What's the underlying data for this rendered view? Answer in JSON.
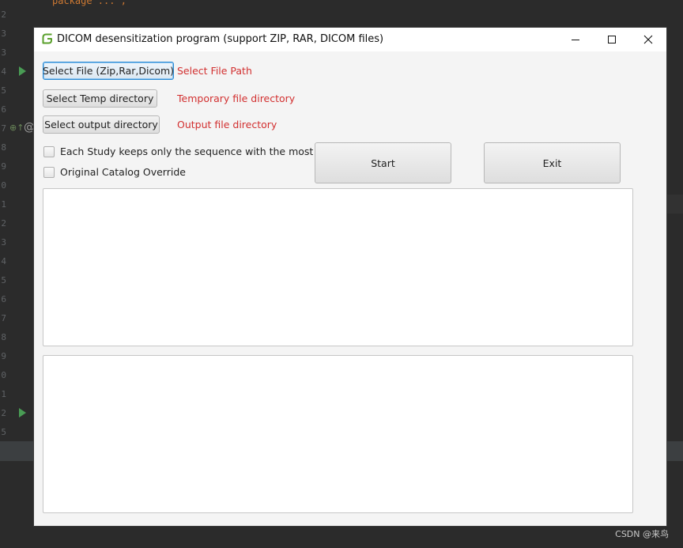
{
  "ide": {
    "line_numbers": [
      "2",
      "3",
      "3",
      "4",
      "5",
      "6",
      "7",
      "8",
      "9",
      "0",
      "1",
      "2",
      "3",
      "4",
      "5",
      "6",
      "7",
      "8",
      "9",
      "0",
      "1",
      "2",
      "5"
    ],
    "code_fragment": "package ... ;"
  },
  "window": {
    "title": "DICOM desensitization program (support ZIP, RAR, DICOM files)"
  },
  "buttons": {
    "select_file": "Select File (Zip,Rar,Dicom)",
    "select_temp": "Select Temp  directory",
    "select_output": "Select output directory",
    "start": "Start",
    "exit": "Exit"
  },
  "labels": {
    "file_path": "Select File Path",
    "temp_dir": "Temporary file directory",
    "output_dir": "Output file directory"
  },
  "checkboxes": {
    "keep_most_files": "Each Study keeps only the sequence with the most files",
    "override": "Original Catalog Override"
  },
  "colors": {
    "path_label": "#d23030",
    "focus_border": "#2a8ad4",
    "app_icon": "#5aa02c"
  },
  "watermark": "CSDN @来鸟"
}
